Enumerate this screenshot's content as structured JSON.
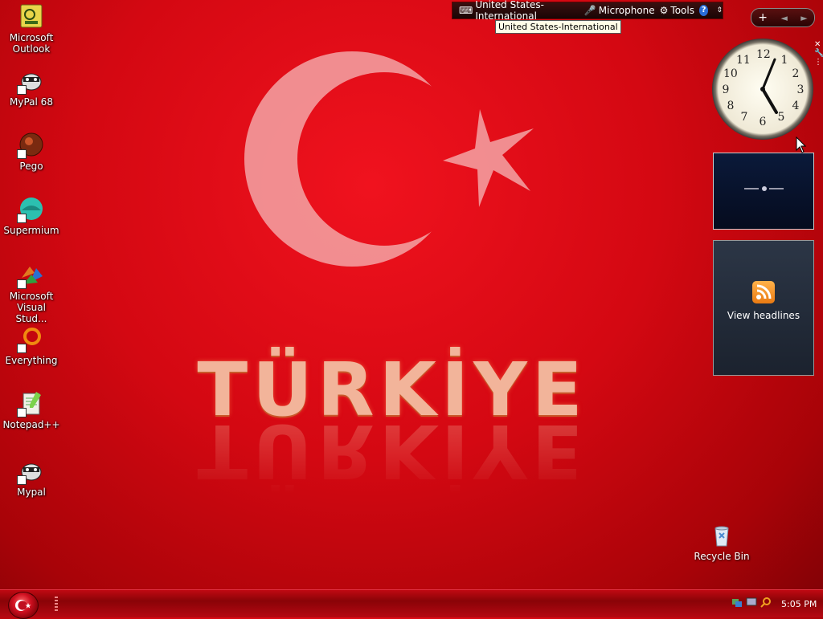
{
  "wallpaper": {
    "title": "TÜRKİYE"
  },
  "desktop_icons": [
    {
      "label": "Microsoft Outlook",
      "icon": "outlook-icon"
    },
    {
      "label": "MyPal 68",
      "icon": "mypal-icon"
    },
    {
      "label": "Pego",
      "icon": "pego-icon"
    },
    {
      "label": "Supermium",
      "icon": "supermium-icon"
    },
    {
      "label": "Microsoft Visual Stud...",
      "icon": "visual-studio-icon"
    },
    {
      "label": "Everything",
      "icon": "everything-icon"
    },
    {
      "label": "Notepad++",
      "icon": "notepadpp-icon"
    },
    {
      "label": "Mypal",
      "icon": "mypal-icon"
    }
  ],
  "language_bar": {
    "language": "United States-International",
    "microphone": "Microphone",
    "tools": "Tools",
    "help": "?",
    "tooltip": "United States-International"
  },
  "sidebar": {
    "add": "+",
    "prev": "◄",
    "next": "►",
    "feeds_label": "View headlines",
    "clock_numbers": [
      "12",
      "1",
      "2",
      "3",
      "4",
      "5",
      "6",
      "7",
      "8",
      "9",
      "10",
      "11"
    ]
  },
  "recycle_bin": {
    "label": "Recycle Bin"
  },
  "taskbar": {
    "time": "5:05 PM"
  },
  "colors": {
    "accent": "#d40812",
    "taskbar": "#8a0307"
  }
}
